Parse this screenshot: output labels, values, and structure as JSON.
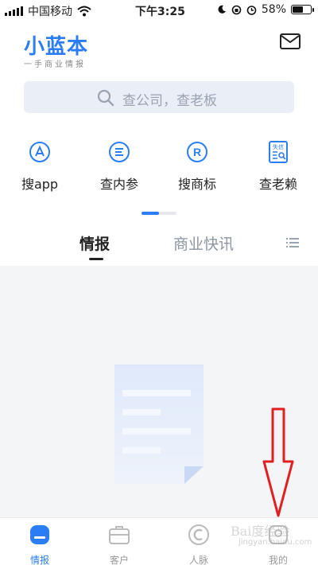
{
  "status_bar": {
    "carrier": "中国移动",
    "time": "下午3:25",
    "battery": "58%",
    "battery_level": 0.58
  },
  "header": {
    "app_name": "小蓝本",
    "slogan": "一手商业情报"
  },
  "search": {
    "placeholder": "查公司，查老板"
  },
  "quick_entries": [
    {
      "label": "搜app",
      "icon": "app-store-icon"
    },
    {
      "label": "查内参",
      "icon": "report-icon"
    },
    {
      "label": "搜商标",
      "icon": "trademark-icon"
    },
    {
      "label": "查老赖",
      "icon": "dishonest-debtor-icon"
    }
  ],
  "quick_icons": {
    "trademark_letter": "R",
    "debtor_badge": "失信"
  },
  "tabs": {
    "active": "情报",
    "inactive": "商业快讯"
  },
  "bottom_nav": [
    {
      "label": "情报",
      "active": true
    },
    {
      "label": "客户",
      "active": false
    },
    {
      "label": "人脉",
      "active": false
    },
    {
      "label": "我的",
      "active": false
    }
  ],
  "watermark": {
    "brand": "Bai度经验",
    "url": "jingyan.baidu.com"
  },
  "colors": {
    "accent": "#2a7df2",
    "annotation": "#e02020"
  }
}
